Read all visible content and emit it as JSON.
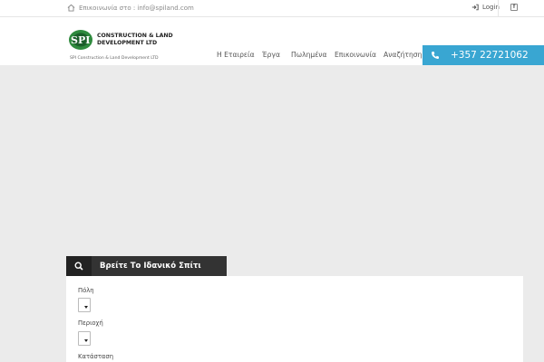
{
  "topbar": {
    "contact_text": "Επικοινωνία στο : info@spiland.com",
    "login_label": "Login"
  },
  "header": {
    "logo_title_line1": "CONSTRUCTION & LAND",
    "logo_title_line2": "DEVELOPMENT LTD",
    "logo_subtitle": "SPI Construction & Land Development LTD",
    "logo_mark_text": "SPI"
  },
  "nav": {
    "items": [
      {
        "label": "Η Εταιρεία"
      },
      {
        "label": "Έργα"
      },
      {
        "label": "Πωλημένα"
      },
      {
        "label": "Επικοινωνία"
      },
      {
        "label": "Αναζήτηση"
      }
    ]
  },
  "phone": {
    "number": "+357 22721062"
  },
  "search": {
    "title": "Βρείτε Το Ιδανικό Σπίτι",
    "fields": [
      {
        "label": "Πόλη"
      },
      {
        "label": "Περιοχή"
      },
      {
        "label": "Κατάσταση"
      }
    ]
  },
  "colors": {
    "accent": "#39a6d2",
    "search_header": "#333333",
    "page_bg": "#ebebeb"
  }
}
